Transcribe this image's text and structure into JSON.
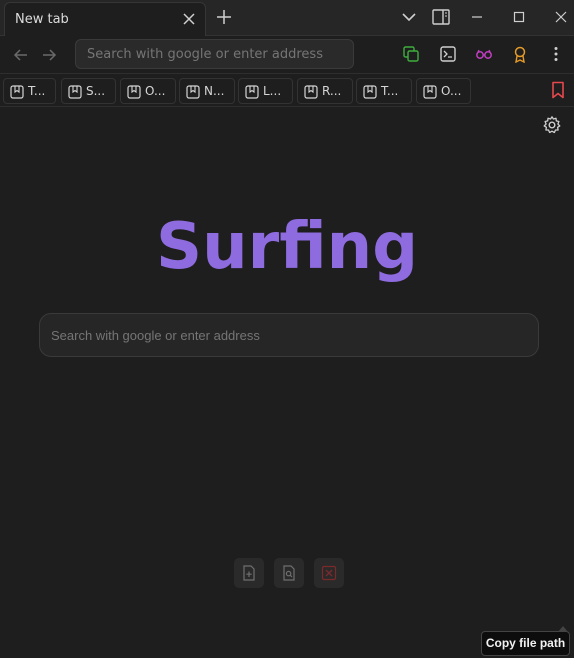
{
  "tabbar": {
    "active_tab_title": "New tab"
  },
  "navbar": {
    "address_placeholder": "Search with google or enter address"
  },
  "bookmarks": {
    "items": [
      {
        "label": "T..."
      },
      {
        "label": "S..."
      },
      {
        "label": "O..."
      },
      {
        "label": "N..."
      },
      {
        "label": "L..."
      },
      {
        "label": "R..."
      },
      {
        "label": "T..."
      },
      {
        "label": "O..."
      }
    ]
  },
  "main": {
    "logo_text": "Surfing",
    "search_placeholder": "Search with google or enter address"
  },
  "tooltip": {
    "text": "Copy file path"
  },
  "colors": {
    "accent_purple": "#8e6bdf",
    "icon_green": "#3fae3f",
    "icon_magenta": "#c03fbf",
    "icon_orange": "#e59b2a",
    "bookmark_flag_red": "#e5484d",
    "delete_red": "#7a2a2a"
  },
  "icons": {
    "tab_close": "close-icon",
    "new_tab": "plus-icon",
    "tab_list": "chevron-down-icon",
    "sidebar_toggle": "sidebar-icon",
    "minimize": "minimize-icon",
    "maximize": "maximize-icon",
    "close_window": "close-icon",
    "back": "arrow-left-icon",
    "forward": "arrow-right-icon",
    "copy": "copy-icon",
    "terminal": "terminal-icon",
    "reading": "glasses-icon",
    "badge": "award-icon",
    "more": "more-vertical-icon",
    "bookmark_item": "bookmark-icon",
    "bookmark_bar": "bookmark-icon",
    "settings": "gear-icon",
    "new_file": "file-plus-icon",
    "search_file": "file-search-icon",
    "delete": "x-square-icon"
  }
}
